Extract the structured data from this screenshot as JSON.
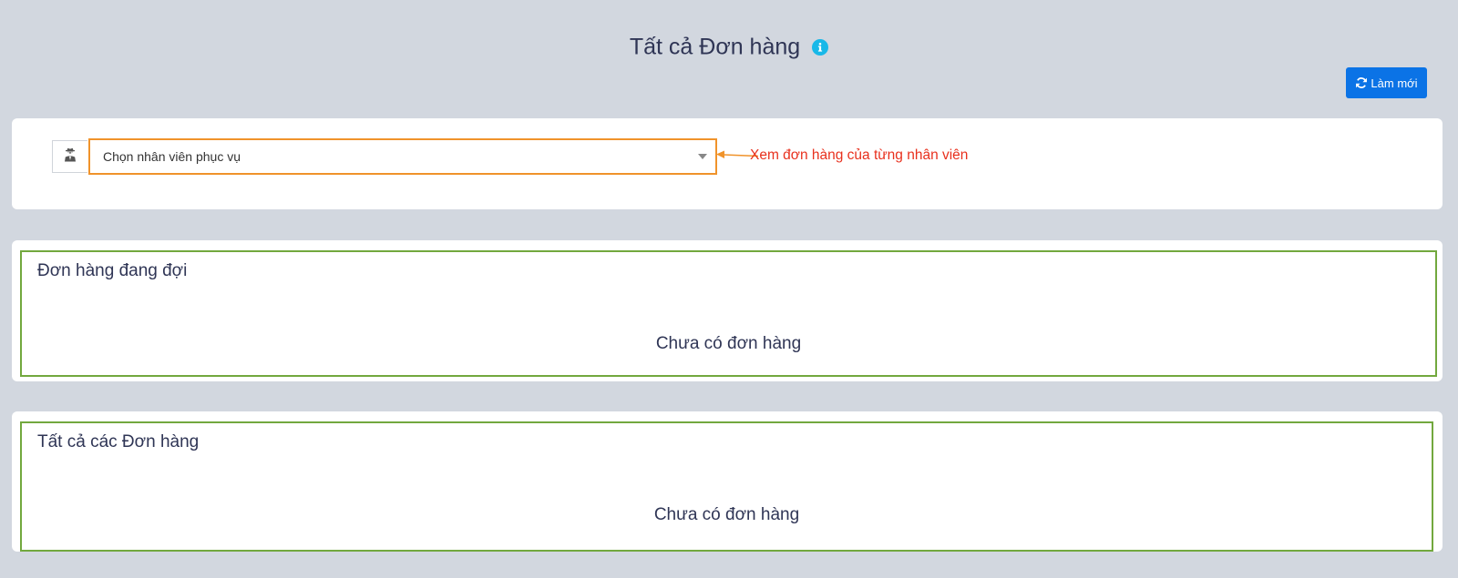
{
  "header": {
    "title": "Tất cả Đơn hàng",
    "info_icon": "info-circle-icon",
    "info_color": "#18b8e8"
  },
  "toolbar": {
    "refresh_label": "Làm mới",
    "refresh_icon": "refresh-icon",
    "refresh_color": "#0b73e6"
  },
  "filter": {
    "staff_icon": "user-secret-icon",
    "staff_select_value": "Chọn nhân viên phục vụ",
    "annotation": "Xem đơn hàng của từng nhân viên",
    "annotation_color": "#e8301d",
    "highlight_color": "#f0932b"
  },
  "panels": {
    "waiting": {
      "title": "Đơn hàng đang đợi",
      "empty_text": "Chưa có đơn hàng"
    },
    "all": {
      "title": "Tất cả các Đơn hàng",
      "empty_text": "Chưa có đơn hàng"
    },
    "highlight_color": "#72a83e"
  }
}
